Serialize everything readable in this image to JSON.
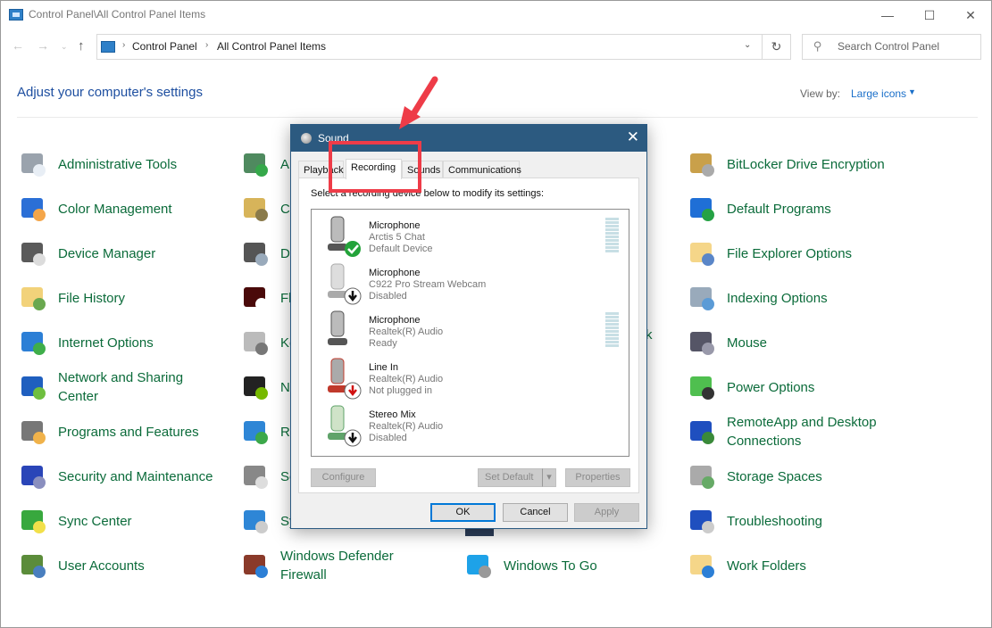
{
  "window": {
    "title": "Control Panel\\All Control Panel Items",
    "controls": {
      "minimize": "—",
      "maximize": "☐",
      "close": "✕"
    }
  },
  "nav": {
    "back": "←",
    "forward": "→",
    "recent": "⌄",
    "up": "↑",
    "breadcrumb": [
      "Control Panel",
      "All Control Panel Items"
    ],
    "crumb_sep": "›",
    "dropdown": "⌄",
    "refresh": "↻",
    "search_placeholder": "Search Control Panel",
    "search_icon": "⚲"
  },
  "header": {
    "title": "Adjust your computer's settings",
    "view_by_label": "View by:",
    "view_by_value": "Large icons",
    "view_by_arrow": "▼"
  },
  "items": {
    "col1": [
      {
        "label": "Administrative Tools",
        "icon": "admin-tools-icon"
      },
      {
        "label": "Color Management",
        "icon": "color-management-icon"
      },
      {
        "label": "Device Manager",
        "icon": "device-manager-icon"
      },
      {
        "label": "File History",
        "icon": "file-history-icon"
      },
      {
        "label": "Internet Options",
        "icon": "internet-options-icon"
      },
      {
        "label": "Network and Sharing Center",
        "icon": "network-icon"
      },
      {
        "label": "Programs and Features",
        "icon": "programs-icon"
      },
      {
        "label": "Security and Maintenance",
        "icon": "flag-icon"
      },
      {
        "label": "Sync Center",
        "icon": "sync-icon"
      },
      {
        "label": "User Accounts",
        "icon": "users-icon"
      }
    ],
    "col2": [
      {
        "label": "A",
        "icon": "autoplay-icon"
      },
      {
        "label": "C",
        "icon": "credential-icon"
      },
      {
        "label": "D",
        "icon": "devices-printers-icon"
      },
      {
        "label": "Fl",
        "icon": "flash-icon"
      },
      {
        "label": "Ke",
        "icon": "keyboard-icon"
      },
      {
        "label": "N",
        "icon": "nvidia-icon"
      },
      {
        "label": "R",
        "icon": "recovery-icon"
      },
      {
        "label": "So",
        "icon": "sound-icon"
      },
      {
        "label": "Sy",
        "icon": "system-icon"
      },
      {
        "label": "Windows Defender Firewall",
        "icon": "firewall-icon"
      }
    ],
    "col3": [
      {
        "label": "Windows To Go",
        "icon": "windows-to-go-icon"
      }
    ],
    "col3_partial": "k",
    "col4": [
      {
        "label": "BitLocker Drive Encryption",
        "icon": "bitlocker-icon"
      },
      {
        "label": "Default Programs",
        "icon": "default-programs-icon"
      },
      {
        "label": "File Explorer Options",
        "icon": "folder-options-icon"
      },
      {
        "label": "Indexing Options",
        "icon": "indexing-icon"
      },
      {
        "label": "Mouse",
        "icon": "mouse-icon"
      },
      {
        "label": "Power Options",
        "icon": "power-icon"
      },
      {
        "label": "RemoteApp and Desktop Connections",
        "icon": "remoteapp-icon"
      },
      {
        "label": "Storage Spaces",
        "icon": "storage-icon"
      },
      {
        "label": "Troubleshooting",
        "icon": "troubleshoot-icon"
      },
      {
        "label": "Work Folders",
        "icon": "work-folders-icon"
      }
    ]
  },
  "dialog": {
    "title": "Sound",
    "close": "✕",
    "tabs": [
      "Playback",
      "Recording",
      "Sounds",
      "Communications"
    ],
    "active_tab": "Recording",
    "instruction": "Select a recording device below to modify its settings:",
    "devices": [
      {
        "name": "Microphone",
        "sub": "Arctis 5 Chat",
        "status": "Default Device",
        "badge": "check",
        "meter": true
      },
      {
        "name": "Microphone",
        "sub": "C922 Pro Stream Webcam",
        "status": "Disabled",
        "badge": "down",
        "meter": false
      },
      {
        "name": "Microphone",
        "sub": "Realtek(R) Audio",
        "status": "Ready",
        "badge": "none",
        "meter": true
      },
      {
        "name": "Line In",
        "sub": "Realtek(R) Audio",
        "status": "Not plugged in",
        "badge": "down-red",
        "meter": false
      },
      {
        "name": "Stereo Mix",
        "sub": "Realtek(R) Audio",
        "status": "Disabled",
        "badge": "down",
        "meter": false
      }
    ],
    "buttons": {
      "configure": "Configure",
      "set_default": "Set Default",
      "set_default_arrow": "▾",
      "properties": "Properties",
      "ok": "OK",
      "cancel": "Cancel",
      "apply": "Apply"
    }
  },
  "colors": {
    "link_green": "#0b6b3a",
    "heading_blue": "#1e4fa0",
    "dialog_title": "#2c5a80",
    "annotation_red": "#ee3c48",
    "focus_blue": "#0078d7"
  }
}
